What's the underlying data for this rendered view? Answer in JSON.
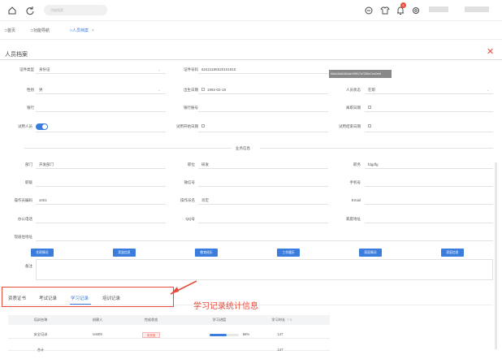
{
  "topbar": {
    "search_placeholder": "功能搜索",
    "notification_count": "5"
  },
  "tabs": [
    {
      "label": "首页"
    },
    {
      "label": "功能导航"
    },
    {
      "label": "人员档案"
    }
  ],
  "panel": {
    "title": "人员档案"
  },
  "form": {
    "cert_type_label": "证件类型",
    "cert_type_value": "身份证",
    "cert_no_label": "证件号码",
    "cert_no_value": "62421195020101910",
    "gender_label": "性别",
    "gender_value": "男",
    "birthday_label": "出生日期",
    "birthday_value": "1992-02-18",
    "status_label": "人员状态",
    "status_value": "在职",
    "bank_label": "银行",
    "bank_account_label": "银行账号",
    "leave_date_label": "离职日期",
    "trial_label": "试用人员",
    "trial_start_label": "试用开始日期",
    "trial_end_label": "试用结束日期"
  },
  "tooltip": "65a44dd0464de19f917a7280e7ce2efd",
  "business": {
    "section_title": "业务信息",
    "dept_label": "部门",
    "dept_value": "开发部门",
    "position_label": "职位",
    "position_value": "研发",
    "duty_label": "职务",
    "duty_value": "fdgdfg",
    "rank_label": "职级",
    "wechat_label": "微信号",
    "mobile_label": "手机号",
    "op_code_label": "操作员编码",
    "op_code_value": "x001",
    "op_name_label": "操作员名",
    "op_name_value": "肖宏",
    "email_label": "Email",
    "office_phone_label": "办公电话",
    "qq_label": "QQ号",
    "home_addr_label": "家庭地址",
    "current_addr_label": "现居住地址",
    "remark_label": "备注"
  },
  "buttons": [
    {
      "label": "任职情况"
    },
    {
      "label": "奖励信息"
    },
    {
      "label": "教育经历"
    },
    {
      "label": "工作履历"
    },
    {
      "label": "家庭情况"
    },
    {
      "label": "家庭信息"
    }
  ],
  "subtabs": [
    {
      "label": "资质证书"
    },
    {
      "label": "考试记录"
    },
    {
      "label": "学习记录"
    },
    {
      "label": "培训记录"
    }
  ],
  "annotation": "学习记录统计信息",
  "table": {
    "headers": [
      "培训名称",
      "创建人",
      "完成状态",
      "学习进度",
      "学习时长"
    ],
    "rows": [
      {
        "name": "安全培训",
        "creator": "test09",
        "status": "未完成",
        "progress": "58%",
        "progress_value": 58,
        "duration": "147"
      }
    ],
    "total": {
      "label": "合计",
      "duration": "147"
    }
  },
  "colors": {
    "accent": "#3b7ddd",
    "alert": "#e74c3c"
  }
}
